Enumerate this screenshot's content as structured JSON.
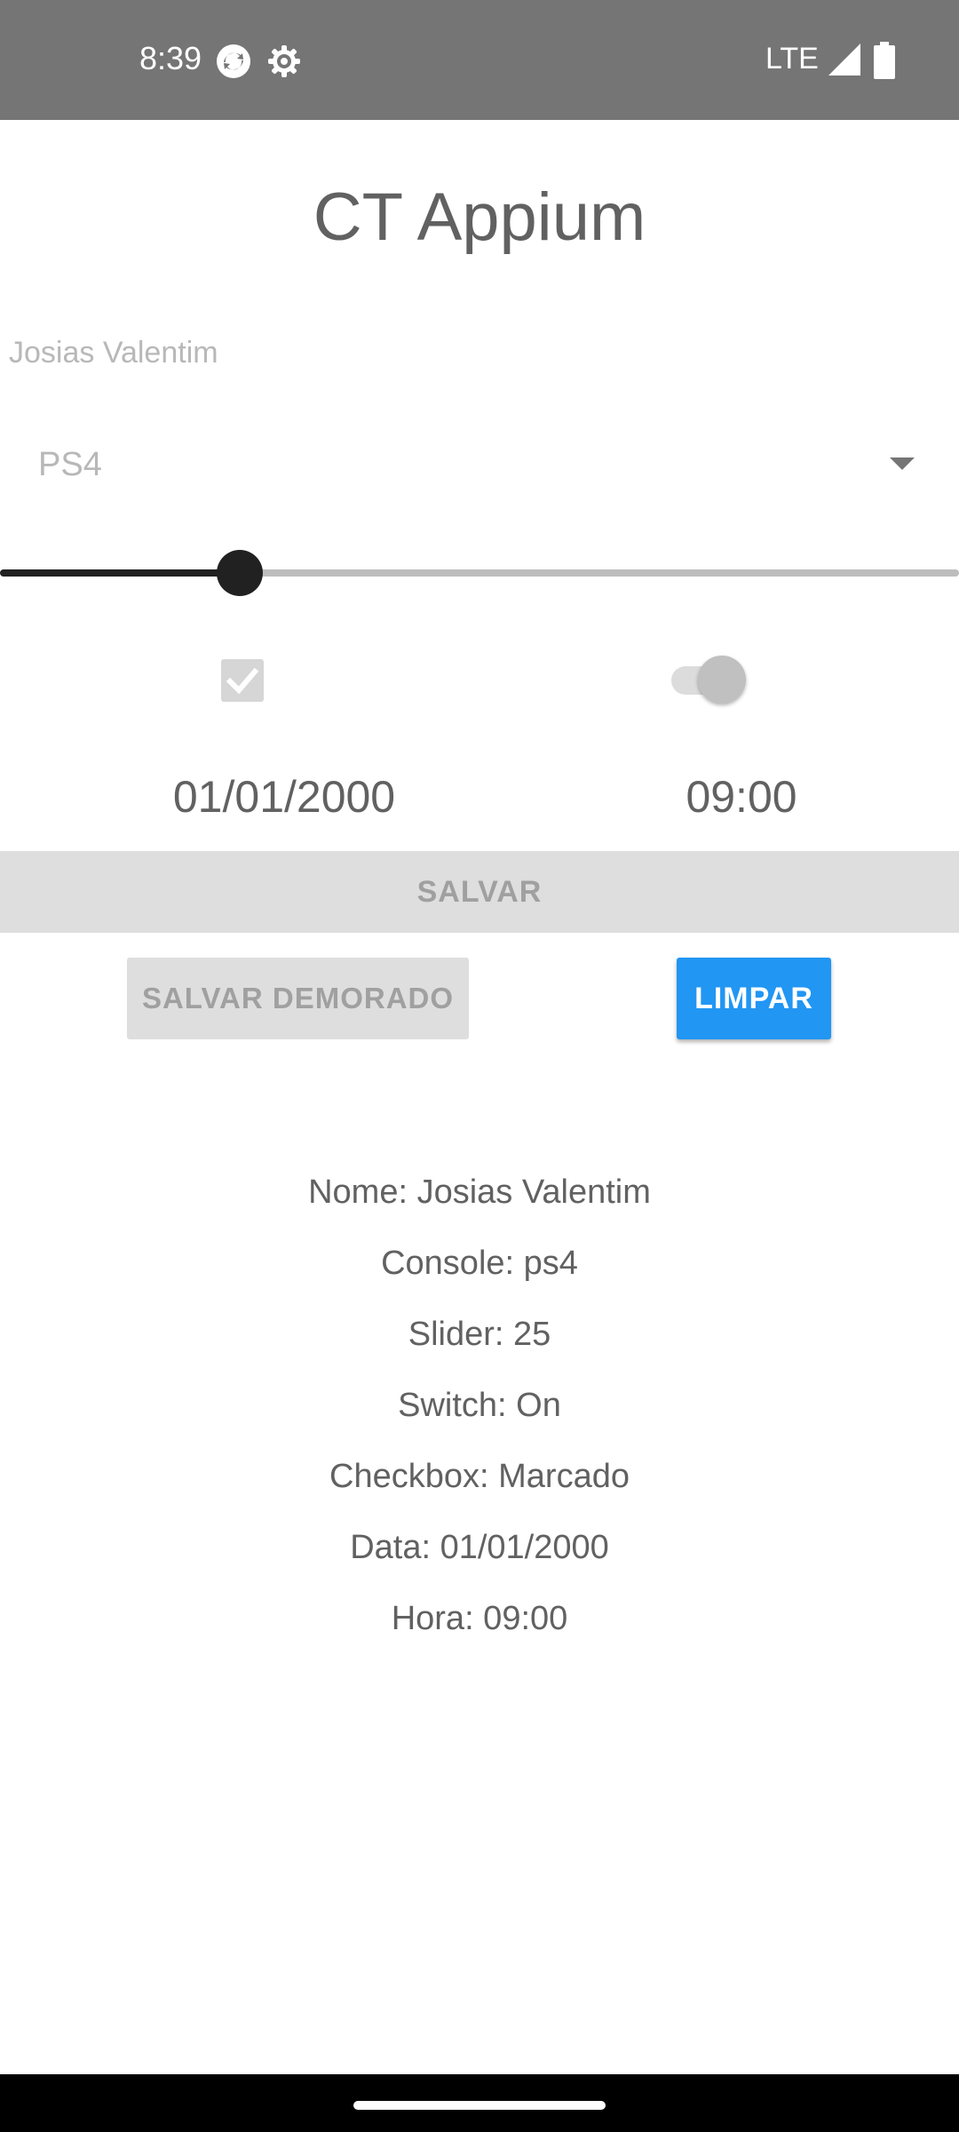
{
  "status_bar": {
    "time": "8:39",
    "network": "LTE",
    "icons": [
      "sync-icon",
      "settings-icon",
      "signal-icon",
      "battery-icon"
    ]
  },
  "app": {
    "title": "CT Appium"
  },
  "form": {
    "name_value": "Josias Valentim",
    "console_selected": "PS4",
    "slider_value": 25,
    "slider_max": 100,
    "checkbox_checked": true,
    "switch_on": true,
    "date": "01/01/2000",
    "time": "09:00"
  },
  "buttons": {
    "save_label": "SALVAR",
    "save_delayed_label": "SALVAR DEMORADO",
    "clear_label": "LIMPAR"
  },
  "results": {
    "name": "Nome: Josias Valentim",
    "console": "Console: ps4",
    "slider": "Slider: 25",
    "switch": "Switch: On",
    "checkbox": "Checkbox: Marcado",
    "date": "Data: 01/01/2000",
    "time": "Hora: 09:00"
  },
  "colors": {
    "status_bar": "#757575",
    "accent_button": "#2196f3",
    "disabled_button": "#dedede",
    "text": "#616161"
  }
}
